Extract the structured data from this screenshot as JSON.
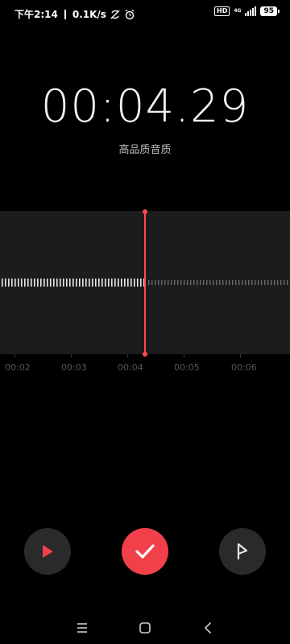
{
  "status_bar": {
    "time": "下午2:14",
    "network_speed": "0.1K/s",
    "network_type": "4G",
    "battery": "95",
    "icons": [
      "no-sync-icon",
      "alarm-icon",
      "hd-icon",
      "signal-icon",
      "battery-icon"
    ]
  },
  "recorder": {
    "elapsed": "00:04.29",
    "quality_label": "高品质音质"
  },
  "timeline": {
    "labels": [
      "00:02",
      "00:03",
      "00:04",
      "00:05",
      "00:06"
    ]
  },
  "controls": {
    "play_icon": "play-icon",
    "save_icon": "check-icon",
    "flag_icon": "flag-icon"
  },
  "colors": {
    "accent": "#f1404a",
    "playhead": "#ff4a50",
    "background": "#000000",
    "wave_panel": "#1c1c1c"
  }
}
